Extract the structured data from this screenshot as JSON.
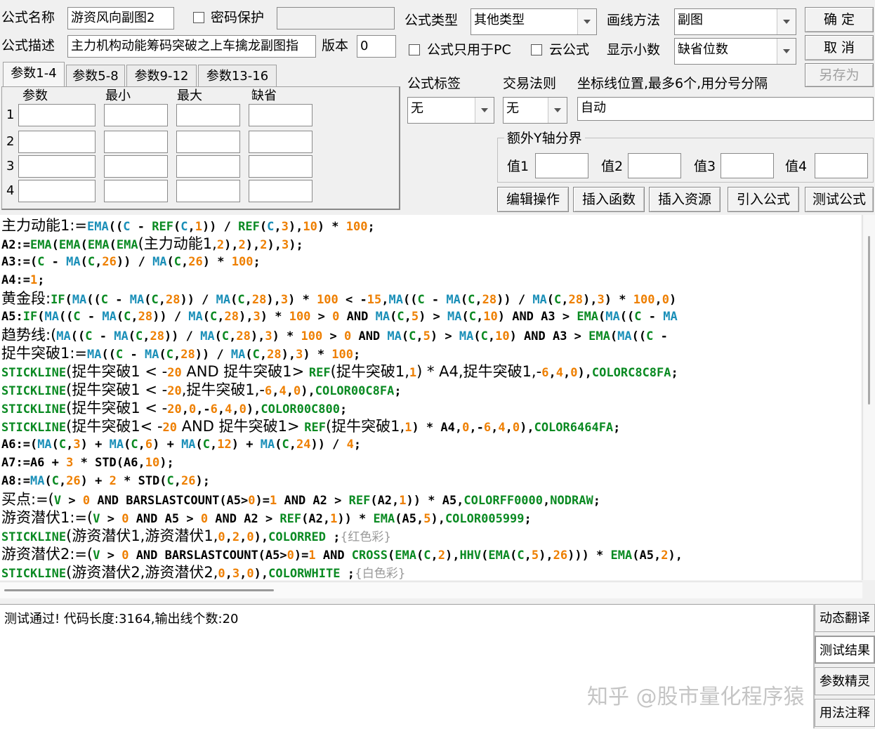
{
  "form": {
    "name_label": "公式名称",
    "name_value": "游资风向副图2",
    "password_label": "密码保护",
    "desc_label": "公式描述",
    "desc_value": "主力机构动能筹码突破之上车擒龙副图指",
    "version_label": "版本",
    "version_value": "0",
    "type_label": "公式类型",
    "type_value": "其他类型",
    "draw_label": "画线方法",
    "draw_value": "副图",
    "pc_only_label": "公式只用于PC",
    "cloud_label": "云公式",
    "decimal_label": "显示小数",
    "decimal_value": "缺省位数",
    "tag_label": "公式标签",
    "tag_value": "无",
    "rule_label": "交易法则",
    "rule_value": "无",
    "coord_label": "坐标线位置,最多6个,用分号分隔",
    "coord_value": "自动",
    "yaxis_group": "额外Y轴分界",
    "y1": "值1",
    "y2": "值2",
    "y3": "值3",
    "y4": "值4"
  },
  "buttons": {
    "ok": "确 定",
    "cancel": "取 消",
    "save_as": "另存为",
    "edit": "编辑操作",
    "insert_func": "插入函数",
    "insert_res": "插入资源",
    "import": "引入公式",
    "test": "测试公式"
  },
  "param_tabs": [
    "参数1-4",
    "参数5-8",
    "参数9-12",
    "参数13-16"
  ],
  "param_headers": [
    "参数",
    "最小",
    "最大",
    "缺省"
  ],
  "param_rows": [
    "1",
    "2",
    "3",
    "4"
  ],
  "code_lines": [
    [
      [
        "k",
        "主力动能1:="
      ],
      [
        "f",
        "EMA"
      ],
      [
        "k",
        "(("
      ],
      [
        "f",
        "C"
      ],
      [
        "k",
        " - "
      ],
      [
        "s",
        "REF"
      ],
      [
        "k",
        "("
      ],
      [
        "f",
        "C"
      ],
      [
        "k",
        ","
      ],
      [
        "n",
        "1"
      ],
      [
        "k",
        ")) / "
      ],
      [
        "s",
        "REF"
      ],
      [
        "k",
        "("
      ],
      [
        "f",
        "C"
      ],
      [
        "k",
        ","
      ],
      [
        "n",
        "3"
      ],
      [
        "k",
        "),"
      ],
      [
        "n",
        "10"
      ],
      [
        "k",
        ") * "
      ],
      [
        "n",
        "100"
      ],
      [
        "k",
        ";"
      ]
    ],
    [
      [
        "k",
        "A2:="
      ],
      [
        "s",
        "EMA"
      ],
      [
        "k",
        "("
      ],
      [
        "s",
        "EMA"
      ],
      [
        "k",
        "("
      ],
      [
        "s",
        "EMA"
      ],
      [
        "k",
        "("
      ],
      [
        "s",
        "EMA"
      ],
      [
        "k",
        "(主力动能1,"
      ],
      [
        "n",
        "2"
      ],
      [
        "k",
        "),"
      ],
      [
        "n",
        "2"
      ],
      [
        "k",
        "),"
      ],
      [
        "n",
        "2"
      ],
      [
        "k",
        "),"
      ],
      [
        "n",
        "3"
      ],
      [
        "k",
        ");"
      ]
    ],
    [
      [
        "k",
        "A3:=("
      ],
      [
        "s",
        "C"
      ],
      [
        "k",
        " - "
      ],
      [
        "f",
        "MA"
      ],
      [
        "k",
        "("
      ],
      [
        "s",
        "C"
      ],
      [
        "k",
        ","
      ],
      [
        "n",
        "26"
      ],
      [
        "k",
        ")) / "
      ],
      [
        "f",
        "MA"
      ],
      [
        "k",
        "("
      ],
      [
        "s",
        "C"
      ],
      [
        "k",
        ","
      ],
      [
        "n",
        "26"
      ],
      [
        "k",
        ") * "
      ],
      [
        "n",
        "100"
      ],
      [
        "k",
        ";"
      ]
    ],
    [
      [
        "k",
        "A4:="
      ],
      [
        "n",
        "1"
      ],
      [
        "k",
        ";"
      ]
    ],
    [
      [
        "k",
        "黄金段:"
      ],
      [
        "s",
        "IF"
      ],
      [
        "k",
        "("
      ],
      [
        "f",
        "MA"
      ],
      [
        "k",
        "(("
      ],
      [
        "s",
        "C"
      ],
      [
        "k",
        " - "
      ],
      [
        "f",
        "MA"
      ],
      [
        "k",
        "("
      ],
      [
        "s",
        "C"
      ],
      [
        "k",
        ","
      ],
      [
        "n",
        "28"
      ],
      [
        "k",
        ")) / "
      ],
      [
        "f",
        "MA"
      ],
      [
        "k",
        "("
      ],
      [
        "s",
        "C"
      ],
      [
        "k",
        ","
      ],
      [
        "n",
        "28"
      ],
      [
        "k",
        "),"
      ],
      [
        "n",
        "3"
      ],
      [
        "k",
        ") * "
      ],
      [
        "n",
        "100"
      ],
      [
        "k",
        " < -"
      ],
      [
        "n",
        "15"
      ],
      [
        "k",
        ","
      ],
      [
        "f",
        "MA"
      ],
      [
        "k",
        "(("
      ],
      [
        "s",
        "C"
      ],
      [
        "k",
        " - "
      ],
      [
        "f",
        "MA"
      ],
      [
        "k",
        "("
      ],
      [
        "s",
        "C"
      ],
      [
        "k",
        ","
      ],
      [
        "n",
        "28"
      ],
      [
        "k",
        ")) / "
      ],
      [
        "f",
        "MA"
      ],
      [
        "k",
        "("
      ],
      [
        "s",
        "C"
      ],
      [
        "k",
        ","
      ],
      [
        "n",
        "28"
      ],
      [
        "k",
        "),"
      ],
      [
        "n",
        "3"
      ],
      [
        "k",
        ") * "
      ],
      [
        "n",
        "100"
      ],
      [
        "k",
        ","
      ],
      [
        "n",
        "0"
      ],
      [
        "k",
        ")"
      ]
    ],
    [
      [
        "k",
        "A5:"
      ],
      [
        "s",
        "IF"
      ],
      [
        "k",
        "("
      ],
      [
        "f",
        "MA"
      ],
      [
        "k",
        "(("
      ],
      [
        "s",
        "C"
      ],
      [
        "k",
        " - "
      ],
      [
        "f",
        "MA"
      ],
      [
        "k",
        "("
      ],
      [
        "s",
        "C"
      ],
      [
        "k",
        ","
      ],
      [
        "n",
        "28"
      ],
      [
        "k",
        ")) / "
      ],
      [
        "f",
        "MA"
      ],
      [
        "k",
        "("
      ],
      [
        "s",
        "C"
      ],
      [
        "k",
        ","
      ],
      [
        "n",
        "28"
      ],
      [
        "k",
        "),"
      ],
      [
        "n",
        "3"
      ],
      [
        "k",
        ") * "
      ],
      [
        "n",
        "100"
      ],
      [
        "k",
        " > "
      ],
      [
        "n",
        "0"
      ],
      [
        "k",
        " AND "
      ],
      [
        "f",
        "MA"
      ],
      [
        "k",
        "("
      ],
      [
        "s",
        "C"
      ],
      [
        "k",
        ","
      ],
      [
        "n",
        "5"
      ],
      [
        "k",
        ") > "
      ],
      [
        "f",
        "MA"
      ],
      [
        "k",
        "("
      ],
      [
        "s",
        "C"
      ],
      [
        "k",
        ","
      ],
      [
        "n",
        "10"
      ],
      [
        "k",
        ") AND A3 > "
      ],
      [
        "s",
        "EMA"
      ],
      [
        "k",
        "("
      ],
      [
        "f",
        "MA"
      ],
      [
        "k",
        "(("
      ],
      [
        "s",
        "C"
      ],
      [
        "k",
        " - "
      ],
      [
        "f",
        "MA"
      ]
    ],
    [
      [
        "k",
        "趋势线:("
      ],
      [
        "f",
        "MA"
      ],
      [
        "k",
        "(("
      ],
      [
        "s",
        "C"
      ],
      [
        "k",
        " - "
      ],
      [
        "f",
        "MA"
      ],
      [
        "k",
        "("
      ],
      [
        "s",
        "C"
      ],
      [
        "k",
        ","
      ],
      [
        "n",
        "28"
      ],
      [
        "k",
        ")) / "
      ],
      [
        "f",
        "MA"
      ],
      [
        "k",
        "("
      ],
      [
        "s",
        "C"
      ],
      [
        "k",
        ","
      ],
      [
        "n",
        "28"
      ],
      [
        "k",
        "),"
      ],
      [
        "n",
        "3"
      ],
      [
        "k",
        ") * "
      ],
      [
        "n",
        "100"
      ],
      [
        "k",
        " > "
      ],
      [
        "n",
        "0"
      ],
      [
        "k",
        " AND "
      ],
      [
        "f",
        "MA"
      ],
      [
        "k",
        "("
      ],
      [
        "s",
        "C"
      ],
      [
        "k",
        ","
      ],
      [
        "n",
        "5"
      ],
      [
        "k",
        ") > "
      ],
      [
        "f",
        "MA"
      ],
      [
        "k",
        "("
      ],
      [
        "s",
        "C"
      ],
      [
        "k",
        ","
      ],
      [
        "n",
        "10"
      ],
      [
        "k",
        ") AND A3 > "
      ],
      [
        "s",
        "EMA"
      ],
      [
        "k",
        "("
      ],
      [
        "f",
        "MA"
      ],
      [
        "k",
        "(("
      ],
      [
        "s",
        "C"
      ],
      [
        "k",
        " -"
      ]
    ],
    [
      [
        "k",
        "捉牛突破1:="
      ],
      [
        "f",
        "MA"
      ],
      [
        "k",
        "(("
      ],
      [
        "s",
        "C"
      ],
      [
        "k",
        " - "
      ],
      [
        "f",
        "MA"
      ],
      [
        "k",
        "("
      ],
      [
        "s",
        "C"
      ],
      [
        "k",
        ","
      ],
      [
        "n",
        "28"
      ],
      [
        "k",
        ")) / "
      ],
      [
        "f",
        "MA"
      ],
      [
        "k",
        "("
      ],
      [
        "s",
        "C"
      ],
      [
        "k",
        ","
      ],
      [
        "n",
        "28"
      ],
      [
        "k",
        "),"
      ],
      [
        "n",
        "3"
      ],
      [
        "k",
        ") * "
      ],
      [
        "n",
        "100"
      ],
      [
        "k",
        ";"
      ]
    ],
    [
      [
        "s",
        "STICKLINE"
      ],
      [
        "k",
        "(捉牛突破1 < -"
      ],
      [
        "n",
        "20"
      ],
      [
        "k",
        " AND 捉牛突破1> "
      ],
      [
        "s",
        "REF"
      ],
      [
        "k",
        "(捉牛突破1,"
      ],
      [
        "n",
        "1"
      ],
      [
        "k",
        ") * A4,捉牛突破1,-"
      ],
      [
        "n",
        "6"
      ],
      [
        "k",
        ","
      ],
      [
        "n",
        "4"
      ],
      [
        "k",
        ","
      ],
      [
        "n",
        "0"
      ],
      [
        "k",
        "),"
      ],
      [
        "s",
        "COLORC8C8FA"
      ],
      [
        "k",
        ";"
      ]
    ],
    [
      [
        "s",
        "STICKLINE"
      ],
      [
        "k",
        "(捉牛突破1 < -"
      ],
      [
        "n",
        "20"
      ],
      [
        "k",
        ",捉牛突破1,-"
      ],
      [
        "n",
        "6"
      ],
      [
        "k",
        ","
      ],
      [
        "n",
        "4"
      ],
      [
        "k",
        ","
      ],
      [
        "n",
        "0"
      ],
      [
        "k",
        "),"
      ],
      [
        "s",
        "COLOR00C8FA"
      ],
      [
        "k",
        ";"
      ]
    ],
    [
      [
        "s",
        "STICKLINE"
      ],
      [
        "k",
        "(捉牛突破1 < -"
      ],
      [
        "n",
        "20"
      ],
      [
        "k",
        ","
      ],
      [
        "n",
        "0"
      ],
      [
        "k",
        ",-"
      ],
      [
        "n",
        "6"
      ],
      [
        "k",
        ","
      ],
      [
        "n",
        "4"
      ],
      [
        "k",
        ","
      ],
      [
        "n",
        "0"
      ],
      [
        "k",
        "),"
      ],
      [
        "s",
        "COLOR00C800"
      ],
      [
        "k",
        ";"
      ]
    ],
    [
      [
        "s",
        "STICKLINE"
      ],
      [
        "k",
        "(捉牛突破1< -"
      ],
      [
        "n",
        "20"
      ],
      [
        "k",
        " AND 捉牛突破1> "
      ],
      [
        "s",
        "REF"
      ],
      [
        "k",
        "(捉牛突破1,"
      ],
      [
        "n",
        "1"
      ],
      [
        "k",
        ") * A4,"
      ],
      [
        "n",
        "0"
      ],
      [
        "k",
        ",-"
      ],
      [
        "n",
        "6"
      ],
      [
        "k",
        ","
      ],
      [
        "n",
        "4"
      ],
      [
        "k",
        ","
      ],
      [
        "n",
        "0"
      ],
      [
        "k",
        "),"
      ],
      [
        "s",
        "COLOR6464FA"
      ],
      [
        "k",
        ";"
      ]
    ],
    [
      [
        "k",
        "A6:=("
      ],
      [
        "f",
        "MA"
      ],
      [
        "k",
        "("
      ],
      [
        "s",
        "C"
      ],
      [
        "k",
        ","
      ],
      [
        "n",
        "3"
      ],
      [
        "k",
        ") + "
      ],
      [
        "f",
        "MA"
      ],
      [
        "k",
        "("
      ],
      [
        "s",
        "C"
      ],
      [
        "k",
        ","
      ],
      [
        "n",
        "6"
      ],
      [
        "k",
        ") + "
      ],
      [
        "f",
        "MA"
      ],
      [
        "k",
        "("
      ],
      [
        "s",
        "C"
      ],
      [
        "k",
        ","
      ],
      [
        "n",
        "12"
      ],
      [
        "k",
        ") + "
      ],
      [
        "f",
        "MA"
      ],
      [
        "k",
        "("
      ],
      [
        "s",
        "C"
      ],
      [
        "k",
        ","
      ],
      [
        "n",
        "24"
      ],
      [
        "k",
        ")) / "
      ],
      [
        "n",
        "4"
      ],
      [
        "k",
        ";"
      ]
    ],
    [
      [
        "k",
        "A7:=A6 + "
      ],
      [
        "n",
        "3"
      ],
      [
        "k",
        " * STD(A6,"
      ],
      [
        "n",
        "10"
      ],
      [
        "k",
        ");"
      ]
    ],
    [
      [
        "k",
        "A8:="
      ],
      [
        "f",
        "MA"
      ],
      [
        "k",
        "("
      ],
      [
        "s",
        "C"
      ],
      [
        "k",
        ","
      ],
      [
        "n",
        "26"
      ],
      [
        "k",
        ") + "
      ],
      [
        "n",
        "2"
      ],
      [
        "k",
        " * STD("
      ],
      [
        "s",
        "C"
      ],
      [
        "k",
        ","
      ],
      [
        "n",
        "26"
      ],
      [
        "k",
        ");"
      ]
    ],
    [
      [
        "k",
        "买点:=("
      ],
      [
        "s",
        "V"
      ],
      [
        "k",
        " > "
      ],
      [
        "n",
        "0"
      ],
      [
        "k",
        " AND BARSLASTCOUNT(A5>"
      ],
      [
        "n",
        "0"
      ],
      [
        "k",
        ")="
      ],
      [
        "n",
        "1"
      ],
      [
        "k",
        " AND A2 > "
      ],
      [
        "s",
        "REF"
      ],
      [
        "k",
        "(A2,"
      ],
      [
        "n",
        "1"
      ],
      [
        "k",
        ")) * A5,"
      ],
      [
        "s",
        "COLORFF0000"
      ],
      [
        "k",
        ","
      ],
      [
        "s",
        "NODRAW"
      ],
      [
        "k",
        ";"
      ]
    ],
    [
      [
        "k",
        "游资潜伏1:=("
      ],
      [
        "s",
        "V"
      ],
      [
        "k",
        " > "
      ],
      [
        "n",
        "0"
      ],
      [
        "k",
        " AND A5 > "
      ],
      [
        "n",
        "0"
      ],
      [
        "k",
        " AND A2 > "
      ],
      [
        "s",
        "REF"
      ],
      [
        "k",
        "(A2,"
      ],
      [
        "n",
        "1"
      ],
      [
        "k",
        ")) * "
      ],
      [
        "s",
        "EMA"
      ],
      [
        "k",
        "(A5,"
      ],
      [
        "n",
        "5"
      ],
      [
        "k",
        "),"
      ],
      [
        "s",
        "COLOR005999"
      ],
      [
        "k",
        ";"
      ]
    ],
    [
      [
        "s",
        "STICKLINE"
      ],
      [
        "k",
        "(游资潜伏1,游资潜伏1,"
      ],
      [
        "n",
        "0"
      ],
      [
        "k",
        ","
      ],
      [
        "n",
        "2"
      ],
      [
        "k",
        ","
      ],
      [
        "n",
        "0"
      ],
      [
        "k",
        "),"
      ],
      [
        "s",
        "COLORRED"
      ],
      [
        "k",
        " ;"
      ],
      [
        "c",
        "{红色彩}"
      ]
    ],
    [
      [
        "k",
        "游资潜伏2:=("
      ],
      [
        "s",
        "V"
      ],
      [
        "k",
        " > "
      ],
      [
        "n",
        "0"
      ],
      [
        "k",
        " AND BARSLASTCOUNT(A5>"
      ],
      [
        "n",
        "0"
      ],
      [
        "k",
        ")="
      ],
      [
        "n",
        "1"
      ],
      [
        "k",
        " AND "
      ],
      [
        "s",
        "CROSS"
      ],
      [
        "k",
        "("
      ],
      [
        "s",
        "EMA"
      ],
      [
        "k",
        "("
      ],
      [
        "s",
        "C"
      ],
      [
        "k",
        ","
      ],
      [
        "n",
        "2"
      ],
      [
        "k",
        "),"
      ],
      [
        "s",
        "HHV"
      ],
      [
        "k",
        "("
      ],
      [
        "s",
        "EMA"
      ],
      [
        "k",
        "("
      ],
      [
        "s",
        "C"
      ],
      [
        "k",
        ","
      ],
      [
        "n",
        "5"
      ],
      [
        "k",
        "),"
      ],
      [
        "n",
        "26"
      ],
      [
        "k",
        ")))"
      ],
      [
        "k",
        " * "
      ],
      [
        "s",
        "EMA"
      ],
      [
        "k",
        "(A5,"
      ],
      [
        "n",
        "2"
      ],
      [
        "k",
        "),"
      ]
    ],
    [
      [
        "s",
        "STICKLINE"
      ],
      [
        "k",
        "(游资潜伏2,游资潜伏2,"
      ],
      [
        "n",
        "0"
      ],
      [
        "k",
        ","
      ],
      [
        "n",
        "3"
      ],
      [
        "k",
        ","
      ],
      [
        "n",
        "0"
      ],
      [
        "k",
        "),"
      ],
      [
        "s",
        "COLORWHITE"
      ],
      [
        "k",
        " ;"
      ],
      [
        "c",
        "{白色彩}"
      ]
    ]
  ],
  "output": {
    "message": "测试通过! 代码长度:3164,输出线个数:20"
  },
  "side_buttons": [
    "动态翻译",
    "测试结果",
    "参数精灵",
    "用法注释"
  ],
  "watermark": "知乎 @股市量化程序猿"
}
